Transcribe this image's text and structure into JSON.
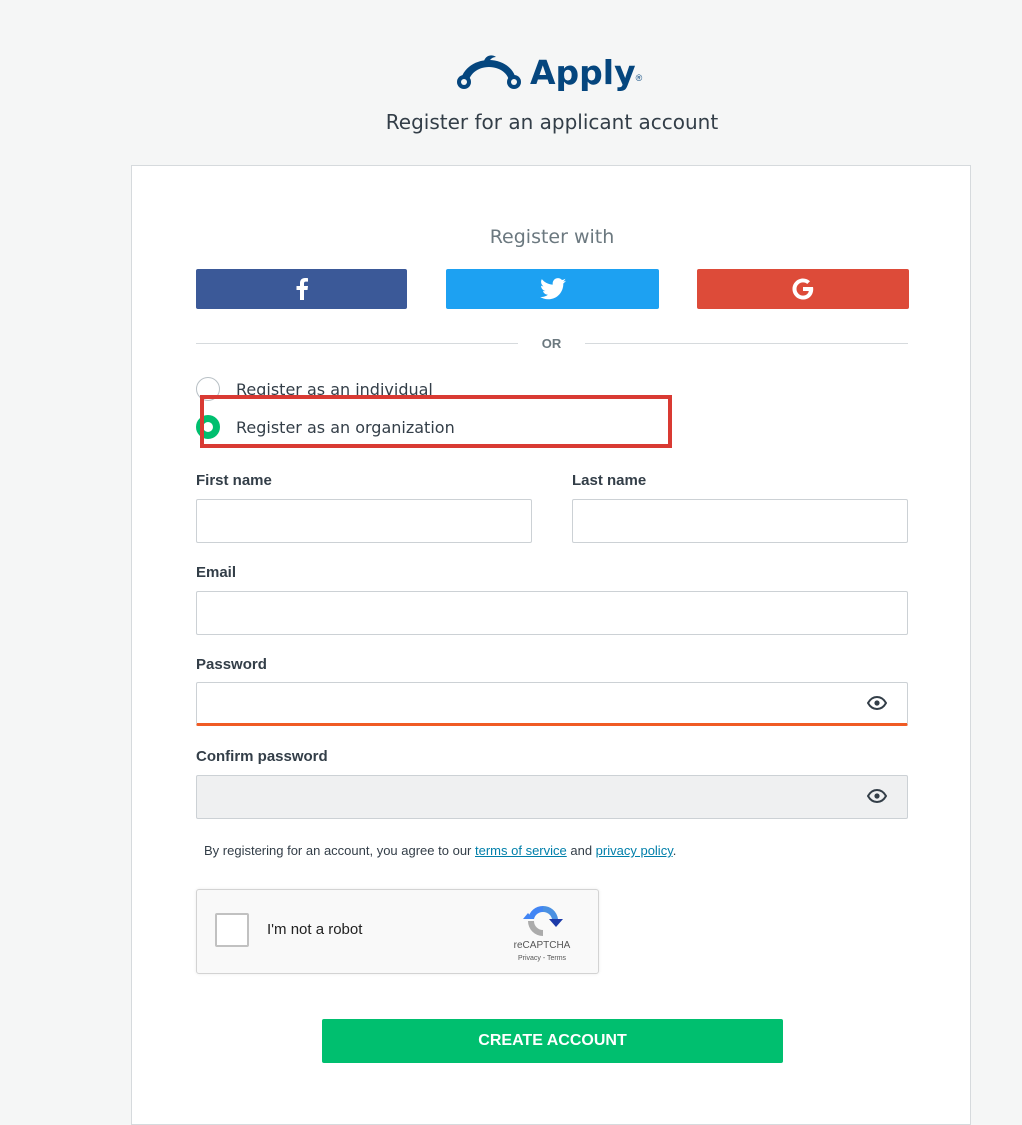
{
  "header": {
    "logo_text": "Apply",
    "logo_mark": "®",
    "subtitle": "Register for an applicant account"
  },
  "social": {
    "heading": "Register with",
    "facebook_icon": "facebook-icon",
    "twitter_icon": "twitter-icon",
    "google_icon": "google-icon",
    "colors": {
      "facebook": "#3b5998",
      "twitter": "#1da1f2",
      "google": "#dd4b39"
    }
  },
  "divider": {
    "or_label": "OR"
  },
  "account_type": {
    "options": [
      {
        "label": "Register as an individual",
        "selected": false
      },
      {
        "label": "Register as an organization",
        "selected": true
      }
    ]
  },
  "form": {
    "first_name_label": "First name",
    "first_name_value": "",
    "last_name_label": "Last name",
    "last_name_value": "",
    "email_label": "Email",
    "email_value": "",
    "password_label": "Password",
    "password_value": "",
    "confirm_password_label": "Confirm password",
    "confirm_password_value": "",
    "eye_icon": "eye-icon"
  },
  "agreement": {
    "prefix": "By registering for an account, you agree to our ",
    "terms_link": "terms of service",
    "middle": " and ",
    "privacy_link": "privacy policy",
    "suffix": "."
  },
  "captcha": {
    "label": "I'm not a robot",
    "brand": "reCAPTCHA",
    "links": "Privacy - Terms"
  },
  "submit": {
    "label": "CREATE ACCOUNT",
    "color": "#00bf6f"
  },
  "accent_colors": {
    "highlight": "#d93a33",
    "password_underline": "#f05b24"
  }
}
